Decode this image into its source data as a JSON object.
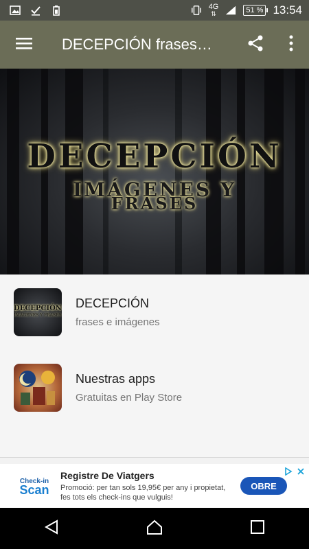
{
  "status_bar": {
    "network": "4G",
    "battery": "51 %",
    "time": "13:54"
  },
  "appbar": {
    "title": "DECEPCIÓN frases…"
  },
  "banner": {
    "title": "DECEPCIÓN",
    "subtitle_line1": "IMÁGENES Y",
    "subtitle_line2": "FRASES"
  },
  "list": [
    {
      "primary": "DECEPCIÓN",
      "secondary": "frases e imágenes",
      "thumb_text": "DECEPCIÓN",
      "thumb_sub": "IMÁGENES Y FRASES"
    },
    {
      "primary": "Nuestras apps",
      "secondary": "Gratuitas en Play Store"
    }
  ],
  "ad": {
    "logo_top": "Check-in",
    "logo_main": "Scan",
    "title": "Registre De Viatgers",
    "description": "Promoció: per tan sols 19,95€ per any i propietat, fes tots els check-ins que vulguis!",
    "cta": "OBRE"
  },
  "colors": {
    "status_bar": "#4e5048",
    "app_bar": "#6b6d57",
    "ad_button": "#1a56b8"
  }
}
